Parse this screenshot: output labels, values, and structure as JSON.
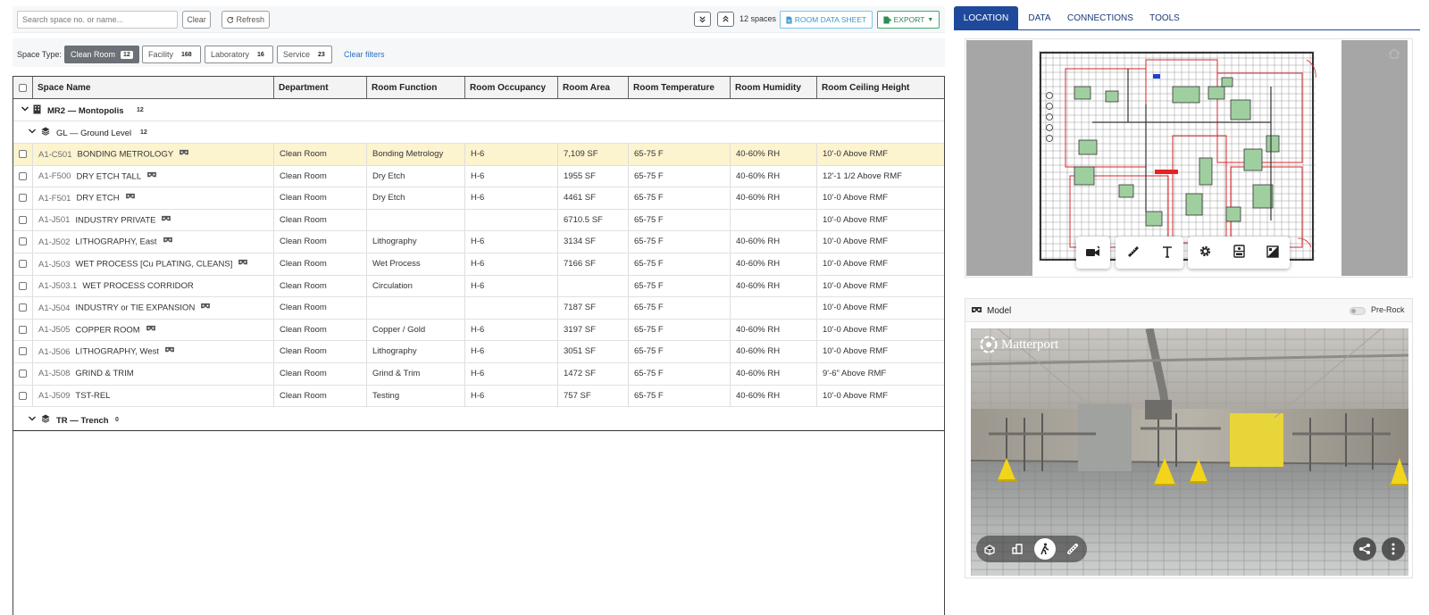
{
  "toolbar": {
    "search_placeholder": "Search space no. or name...",
    "clear_label": "Clear",
    "refresh_label": "Refresh",
    "space_count": "12 spaces",
    "room_data_sheet_label": "ROOM DATA SHEET",
    "export_label": "EXPORT"
  },
  "filters": {
    "label": "Space Type:",
    "chips": [
      {
        "label": "Clean Room",
        "count": "12",
        "active": true
      },
      {
        "label": "Facility",
        "count": "168",
        "active": false
      },
      {
        "label": "Laboratory",
        "count": "16",
        "active": false
      },
      {
        "label": "Service",
        "count": "23",
        "active": false
      }
    ],
    "clear_filters_label": "Clear filters"
  },
  "grid": {
    "columns": [
      "Space Name",
      "Department",
      "Room Function",
      "Room Occupancy",
      "Room Area",
      "Room Temperature",
      "Room Humidity",
      "Room Ceiling Height"
    ],
    "building": {
      "label": "MR2 — Montopolis",
      "count": "12"
    },
    "level_gl": {
      "label": "GL — Ground Level",
      "count": "12"
    },
    "level_tr": {
      "label": "TR — Trench",
      "count": "0"
    },
    "rows": [
      {
        "code": "A1-C501",
        "name": "BONDING METROLOGY",
        "vr": true,
        "dept": "Clean Room",
        "func": "Bonding Metrology",
        "occ": "H-6",
        "area": "7,109 SF",
        "temp": "65-75 F",
        "hum": "40-60% RH",
        "ceil": "10'-0 Above RMF"
      },
      {
        "code": "A1-F500",
        "name": "DRY ETCH TALL",
        "vr": true,
        "dept": "Clean Room",
        "func": "Dry Etch",
        "occ": "H-6",
        "area": "1955 SF",
        "temp": "65-75 F",
        "hum": "40-60% RH",
        "ceil": "12'-1 1/2 Above RMF"
      },
      {
        "code": "A1-F501",
        "name": "DRY ETCH",
        "vr": true,
        "dept": "Clean Room",
        "func": "Dry Etch",
        "occ": "H-6",
        "area": "4461 SF",
        "temp": "65-75 F",
        "hum": "40-60% RH",
        "ceil": "10'-0 Above RMF"
      },
      {
        "code": "A1-J501",
        "name": "INDUSTRY PRIVATE",
        "vr": true,
        "dept": "Clean Room",
        "func": "",
        "occ": "",
        "area": "6710.5 SF",
        "temp": "65-75 F",
        "hum": "",
        "ceil": "10'-0 Above RMF"
      },
      {
        "code": "A1-J502",
        "name": "LITHOGRAPHY, East",
        "vr": true,
        "dept": "Clean Room",
        "func": "Lithography",
        "occ": "H-6",
        "area": "3134 SF",
        "temp": "65-75 F",
        "hum": "40-60% RH",
        "ceil": "10'-0 Above RMF"
      },
      {
        "code": "A1-J503",
        "name": "WET PROCESS [Cu PLATING, CLEANS]",
        "vr": true,
        "dept": "Clean Room",
        "func": "Wet Process",
        "occ": "H-6",
        "area": "7166 SF",
        "temp": "65-75 F",
        "hum": "40-60% RH",
        "ceil": "10'-0 Above RMF"
      },
      {
        "code": "A1-J503.1",
        "name": "WET PROCESS CORRIDOR",
        "vr": false,
        "dept": "Clean Room",
        "func": "Circulation",
        "occ": "H-6",
        "area": "",
        "temp": "65-75 F",
        "hum": "40-60% RH",
        "ceil": "10'-0 Above RMF"
      },
      {
        "code": "A1-J504",
        "name": "INDUSTRY or TIE EXPANSION",
        "vr": true,
        "dept": "Clean Room",
        "func": "",
        "occ": "",
        "area": "7187 SF",
        "temp": "65-75 F",
        "hum": "",
        "ceil": "10'-0 Above RMF"
      },
      {
        "code": "A1-J505",
        "name": "COPPER ROOM",
        "vr": true,
        "dept": "Clean Room",
        "func": "Copper / Gold",
        "occ": "H-6",
        "area": "3197 SF",
        "temp": "65-75 F",
        "hum": "40-60% RH",
        "ceil": "10'-0 Above RMF"
      },
      {
        "code": "A1-J506",
        "name": "LITHOGRAPHY, West",
        "vr": true,
        "dept": "Clean Room",
        "func": "Lithography",
        "occ": "H-6",
        "area": "3051 SF",
        "temp": "65-75 F",
        "hum": "40-60% RH",
        "ceil": "10'-0 Above RMF"
      },
      {
        "code": "A1-J508",
        "name": "GRIND & TRIM",
        "vr": false,
        "dept": "Clean Room",
        "func": "Grind & Trim",
        "occ": "H-6",
        "area": "1472 SF",
        "temp": "65-75 F",
        "hum": "40-60% RH",
        "ceil": "9'-6\" Above RMF"
      },
      {
        "code": "A1-J509",
        "name": "TST-REL",
        "vr": false,
        "dept": "Clean Room",
        "func": "Testing",
        "occ": "H-6",
        "area": "757 SF",
        "temp": "65-75 F",
        "hum": "40-60% RH",
        "ceil": "10'-0 Above RMF"
      }
    ]
  },
  "right_tabs": [
    "LOCATION",
    "DATA",
    "CONNECTIONS",
    "TOOLS"
  ],
  "model": {
    "title": "Model",
    "prerock_label": "Pre-Rock",
    "brand": "Matterport"
  },
  "colors": {
    "tab_active": "#1f4a9c",
    "selected_row": "#fcf3cf",
    "chip_active": "#6b7177",
    "export_green": "#2e8b57",
    "sheet_blue": "#3b98cf"
  }
}
